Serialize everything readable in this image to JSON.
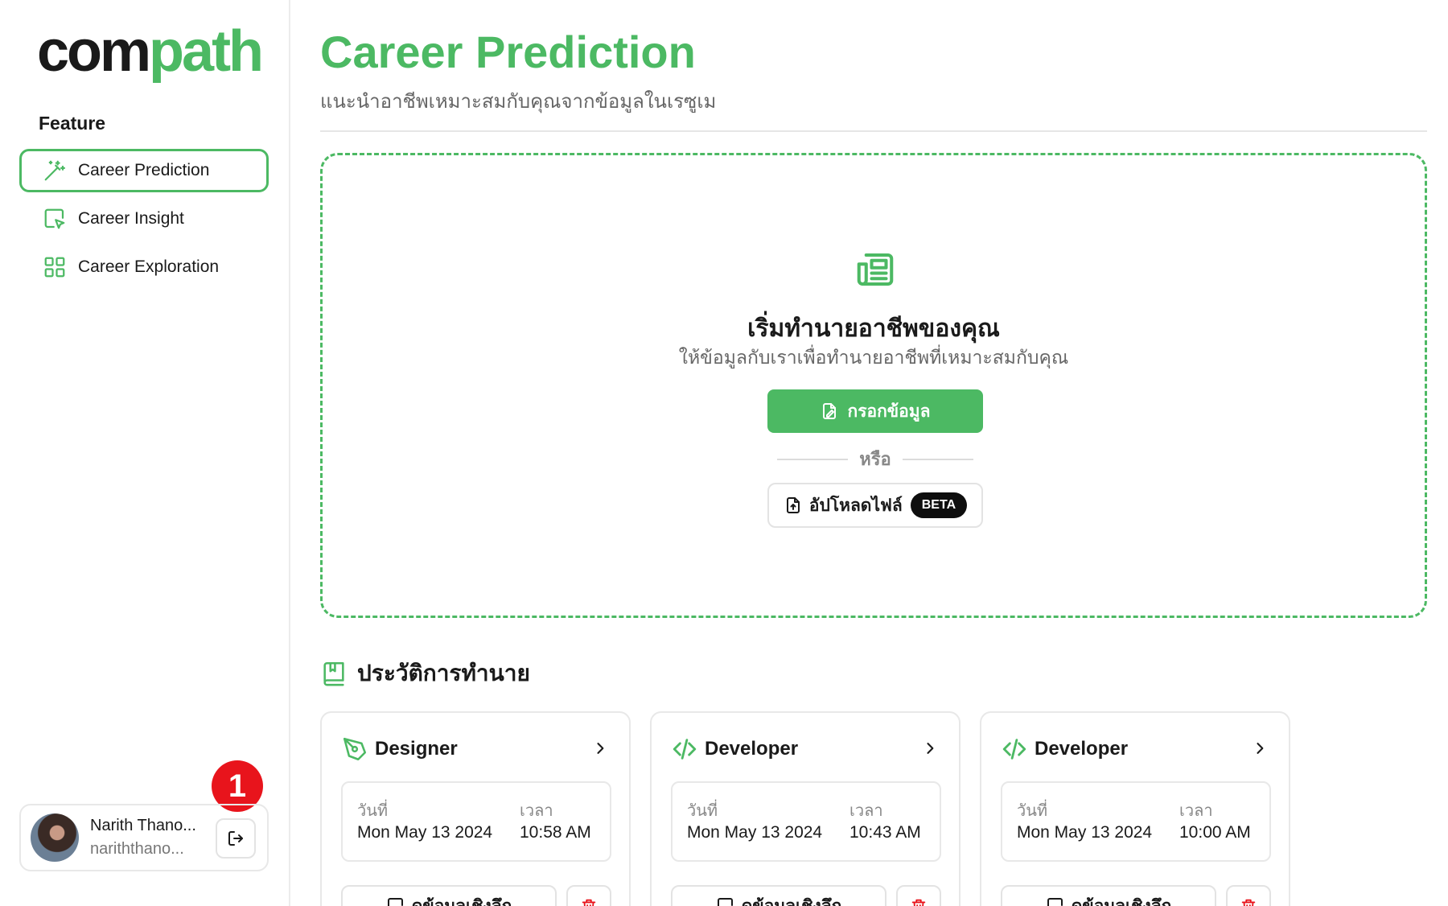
{
  "app": {
    "logo_part1": "com",
    "logo_part2": "path",
    "brand_color": "#4cb963"
  },
  "sidebar": {
    "section_title": "Feature",
    "items": [
      {
        "label": "Career Prediction",
        "icon": "magic-wand-icon",
        "active": true
      },
      {
        "label": "Career Insight",
        "icon": "cursor-click-icon",
        "active": false
      },
      {
        "label": "Career Exploration",
        "icon": "grid-icon",
        "active": false
      }
    ],
    "user": {
      "name": "Narith Thano...",
      "email": "nariththano...",
      "logout_icon": "logout-icon"
    },
    "notification_badge": "1"
  },
  "main": {
    "title": "Career Prediction",
    "subtitle": "แนะนำอาชีพเหมาะสมกับคุณจากข้อมูลในเรซูเม",
    "empty_state": {
      "icon": "newspaper-icon",
      "title": "เริ่มทำนายอาชีพของคุณ",
      "description": "ให้ข้อมูลกับเราเพื่อทำนายอาชีพที่เหมาะสมกับคุณ",
      "primary_button": "กรอกข้อมูล",
      "or_text": "หรือ",
      "upload_button": "อัปโหลดไฟล์",
      "beta_badge": "BETA"
    },
    "history": {
      "title": "ประวัติการทำนาย",
      "date_label": "วันที่",
      "time_label": "เวลา",
      "insight_button": "ดูข้อมูลเชิงลึก",
      "cards": [
        {
          "role": "Designer",
          "icon": "pen-tool-icon",
          "date": "Mon May 13 2024",
          "time": "10:58 AM"
        },
        {
          "role": "Developer",
          "icon": "code-icon",
          "date": "Mon May 13 2024",
          "time": "10:43 AM"
        },
        {
          "role": "Developer",
          "icon": "code-icon",
          "date": "Mon May 13 2024",
          "time": "10:00 AM"
        }
      ]
    }
  }
}
